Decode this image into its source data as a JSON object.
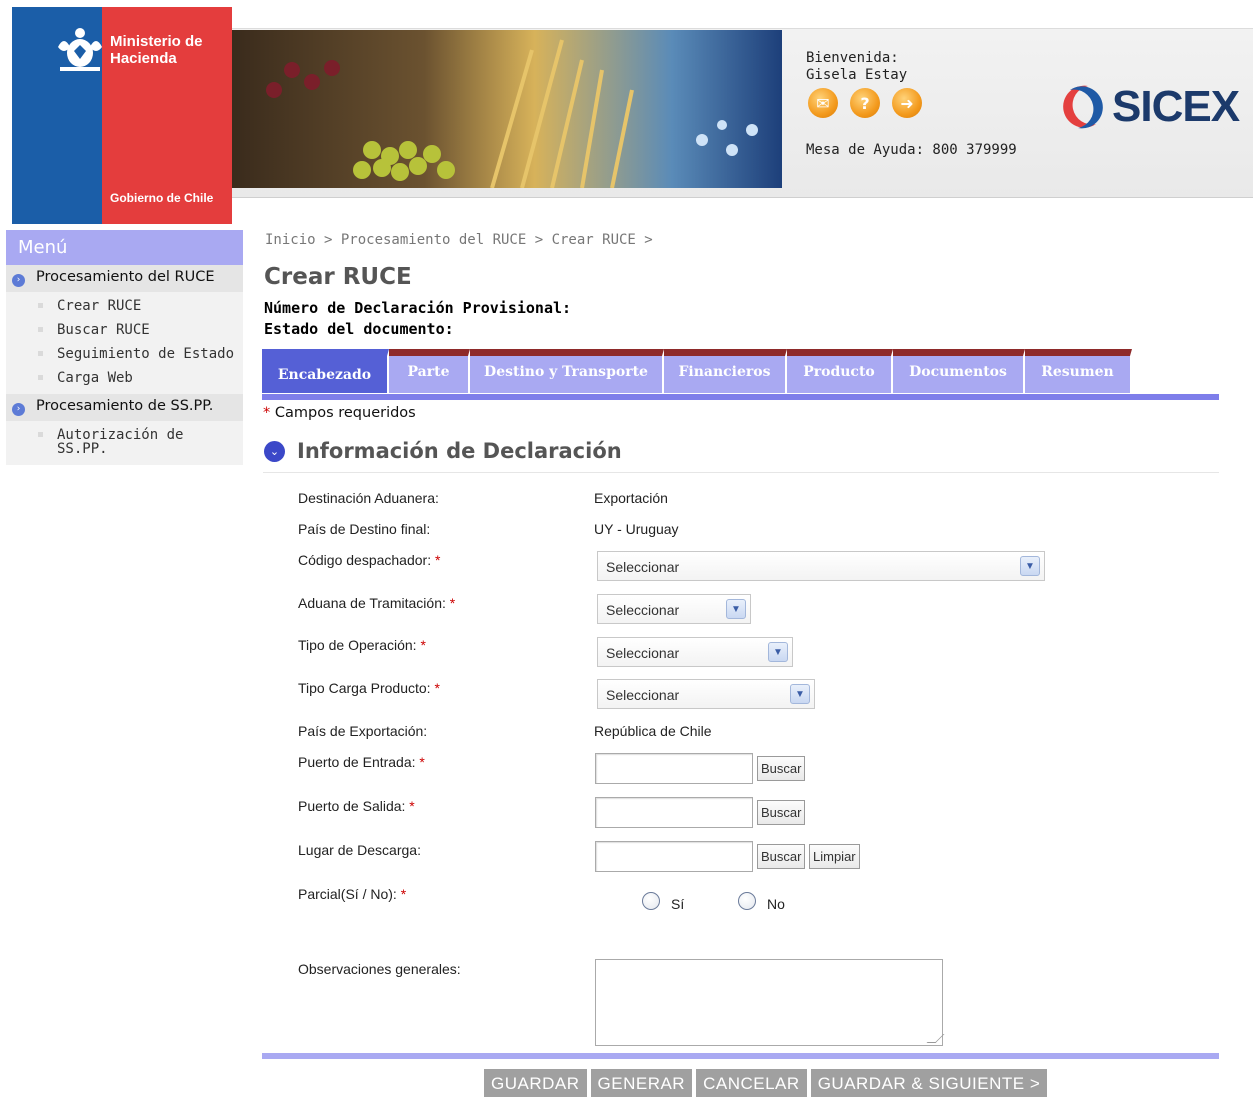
{
  "header": {
    "ministry": "Ministerio de Hacienda",
    "government": "Gobierno de Chile",
    "welcome_label": "Bienvenida:",
    "user_name": "Gisela Estay",
    "helpdesk": "Mesa de Ayuda: 800 379999",
    "brand": "SICEX",
    "icons": [
      "mail-icon",
      "help-icon",
      "logout-arrow-icon"
    ]
  },
  "sidebar": {
    "title": "Menú",
    "sections": [
      {
        "label": "Procesamiento del RUCE",
        "items": [
          "Crear RUCE",
          "Buscar RUCE",
          "Seguimiento de Estado",
          "Carga Web"
        ]
      },
      {
        "label": "Procesamiento de SS.PP.",
        "items": [
          "Autorización de SS.PP."
        ]
      }
    ]
  },
  "breadcrumb": "Inicio > Procesamiento del RUCE > Crear RUCE >",
  "page_title": "Crear RUCE",
  "doc_number_label": "Número de Declaración Provisional:",
  "doc_status_label": "Estado del documento:",
  "tabs": [
    "Encabezado",
    "Parte",
    "Destino y Transporte",
    "Financieros",
    "Producto",
    "Documentos",
    "Resumen"
  ],
  "active_tab": "Encabezado",
  "required_note": "Campos requeridos",
  "section_title": "Información de Declaración",
  "form": {
    "destinacion_label": "Destinación Aduanera:",
    "destinacion_value": "Exportación",
    "pais_destino_label": "País de Destino final:",
    "pais_destino_value": "UY - Uruguay",
    "codigo_label": "Código despachador:",
    "codigo_value": "Seleccionar",
    "aduana_label": "Aduana de Tramitación:",
    "aduana_value": "Seleccionar",
    "tipo_op_label": "Tipo de Operación:",
    "tipo_op_value": "Seleccionar",
    "tipo_carga_label": "Tipo Carga Producto:",
    "tipo_carga_value": "Seleccionar",
    "pais_export_label": "País de Exportación:",
    "pais_export_value": "República de Chile",
    "puerto_entrada_label": "Puerto de Entrada:",
    "puerto_salida_label": "Puerto de Salida:",
    "lugar_descarga_label": "Lugar de Descarga:",
    "buscar": "Buscar",
    "limpiar": "Limpiar",
    "parcial_label": "Parcial(Sí / No):",
    "si": "Sí",
    "no": "No",
    "observaciones_label": "Observaciones generales:"
  },
  "actions": {
    "guardar": "GUARDAR",
    "generar": "GENERAR",
    "cancelar": "CANCELAR",
    "guardar_siguiente": "GUARDAR & SIGUIENTE >"
  },
  "colors": {
    "tab": "#a9a9f2",
    "tab_active": "#5560d6",
    "tab_top": "#8e2a2a",
    "required": "#cc0000",
    "action_button": "#a0a0a0"
  }
}
